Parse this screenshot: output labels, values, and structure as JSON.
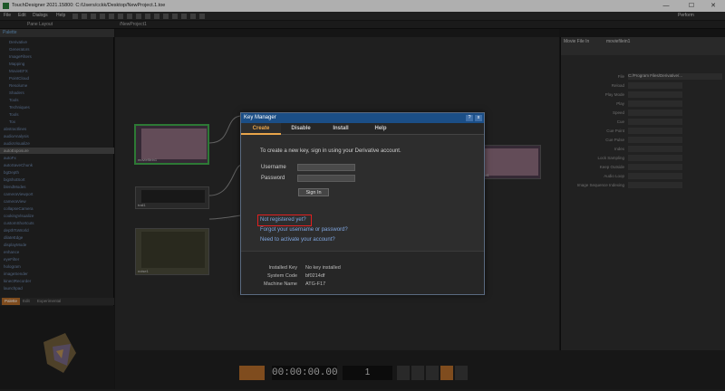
{
  "window": {
    "title": "TouchDesigner 2021.15800: C:/Users/cckk/Desktop/NewProject.1.toe",
    "controls": {
      "minimize": "—",
      "maximize": "☐",
      "close": "✕"
    }
  },
  "menubar": {
    "items": [
      "File",
      "Edit",
      "Dialogs",
      "Help"
    ],
    "perform_label": "Perform"
  },
  "tabs": {
    "project_tab": "Pane Layout",
    "network_tab": "/NewProject1"
  },
  "palette": {
    "header": "Palette",
    "items": [
      "Derivative",
      "Generators",
      "ImageFilters",
      "Mapping",
      "MovieEFX",
      "PointCloud",
      "Resolume",
      "Shaders",
      "Tools",
      "Techniques",
      "Tools",
      "Tox",
      "abstractlines",
      "audioAnalysis",
      "audioVisualize",
      "autoExposure",
      "autoFx",
      "autoSaveChunk",
      "bgDepth",
      "bigShotSort",
      "blendModes",
      "cameraViewport",
      "cameraView",
      "collapseCamera",
      "cookingVisualize",
      "customShortcuts",
      "depthToWorld",
      "dilateEdge",
      "displayMode",
      "enhance",
      "eyeFilter",
      "hologram",
      "imageSender",
      "kinectRecorder",
      "launchpad"
    ],
    "selected_index": 15,
    "tabs": [
      "Palette",
      "Edit",
      "Experimental"
    ]
  },
  "nodes": [
    {
      "label": "moviefilein1"
    },
    {
      "label": "trail1"
    },
    {
      "label": "noise1"
    },
    {
      "label": "out1"
    }
  ],
  "params": {
    "title": "Movie File In",
    "node_name": "moviefilein1",
    "file_value": "C:/Program Files/Derivative/...",
    "rows": [
      "File",
      "Reload",
      "Play Mode",
      "Play",
      "Speed",
      "Cue",
      "Cue Point",
      "Cue Pulse",
      "Index",
      "Lock Sampling",
      "Keep Outside",
      "Audio Loop",
      "Image Sequence Indexing"
    ]
  },
  "timeline": {
    "timecode": "00:00:00.00",
    "frame": "1"
  },
  "key_manager": {
    "title": "Key Manager",
    "help_btn": "?",
    "close_btn": "x",
    "tabs": [
      "Create",
      "Disable",
      "Install",
      "Help"
    ],
    "active_tab": 0,
    "intro": "To create a new key, sign in using your Derivative account.",
    "username_label": "Username",
    "username_value": "",
    "password_label": "Password",
    "password_value": "",
    "signin_label": "Sign In",
    "link_register": "Not registered yet?",
    "link_forgot": "Forgot your username or password?",
    "link_activate": "Need to activate your account?",
    "info": {
      "installed_key_label": "Installed Key",
      "installed_key_value": "No key installed",
      "system_code_label": "System Code",
      "system_code_value": "bf0214df",
      "machine_name_label": "Machine Name",
      "machine_name_value": "ATG-F17"
    }
  }
}
